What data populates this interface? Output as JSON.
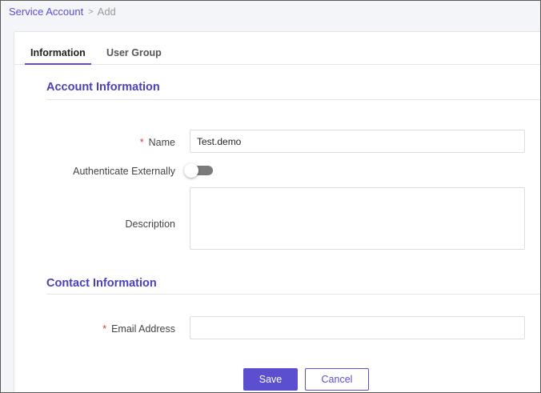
{
  "breadcrumb": {
    "parent": "Service Account",
    "separator": ">",
    "current": "Add"
  },
  "tabs": [
    {
      "label": "Information",
      "active": true
    },
    {
      "label": "User Group",
      "active": false
    }
  ],
  "sections": {
    "account": {
      "title": "Account Information"
    },
    "contact": {
      "title": "Contact Information"
    }
  },
  "fields": {
    "name": {
      "label": "Name",
      "required": true,
      "required_mark": "*",
      "value": "Test.demo"
    },
    "authenticate": {
      "label": "Authenticate Externally",
      "enabled": false
    },
    "description": {
      "label": "Description",
      "value": ""
    },
    "email": {
      "label": "Email Address",
      "required": true,
      "required_mark": "*",
      "value": ""
    }
  },
  "actions": {
    "save_label": "Save",
    "cancel_label": "Cancel"
  },
  "colors": {
    "accent": "#5a4fcf",
    "required": "#e0323a",
    "toggle_off": "#7b7b7b"
  }
}
